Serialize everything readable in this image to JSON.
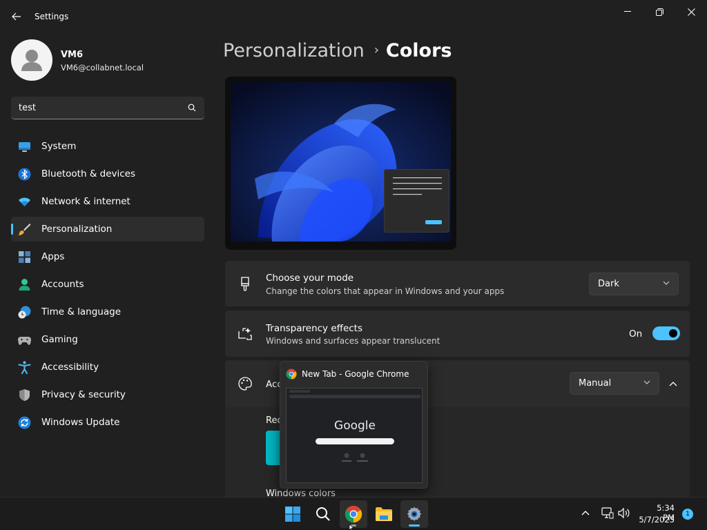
{
  "window": {
    "title": "Settings"
  },
  "profile": {
    "name": "VM6",
    "email": "VM6@collabnet.local"
  },
  "search": {
    "value": "test"
  },
  "nav": {
    "items": [
      {
        "label": "System",
        "icon": "monitor-icon"
      },
      {
        "label": "Bluetooth & devices",
        "icon": "bluetooth-icon"
      },
      {
        "label": "Network & internet",
        "icon": "wifi-icon"
      },
      {
        "label": "Personalization",
        "icon": "paintbrush-icon",
        "active": true
      },
      {
        "label": "Apps",
        "icon": "apps-icon"
      },
      {
        "label": "Accounts",
        "icon": "person-icon"
      },
      {
        "label": "Time & language",
        "icon": "clock-globe-icon"
      },
      {
        "label": "Gaming",
        "icon": "gamepad-icon"
      },
      {
        "label": "Accessibility",
        "icon": "accessibility-icon"
      },
      {
        "label": "Privacy & security",
        "icon": "shield-icon"
      },
      {
        "label": "Windows Update",
        "icon": "update-icon"
      }
    ]
  },
  "breadcrumb": {
    "parent": "Personalization",
    "separator": "›",
    "current": "Colors"
  },
  "mode_card": {
    "title": "Choose your mode",
    "description": "Change the colors that appear in Windows and your apps",
    "value": "Dark"
  },
  "transparency_card": {
    "title": "Transparency effects",
    "description": "Windows and surfaces appear translucent",
    "state_label": "On"
  },
  "accent_card": {
    "title": "Acc",
    "value": "Manual"
  },
  "accent_sub": {
    "recent_label": "Rec",
    "windows_colors_label": "Windows colors"
  },
  "thumbnail": {
    "title": "New Tab - Google Chrome",
    "brand": "Google"
  },
  "taskbar": {
    "time": "5:34 PM",
    "date": "5/7/2023",
    "notifications": "1"
  },
  "colors": {
    "accent": "#4cc2ff",
    "background": "#202020",
    "card": "#2b2b2b"
  }
}
